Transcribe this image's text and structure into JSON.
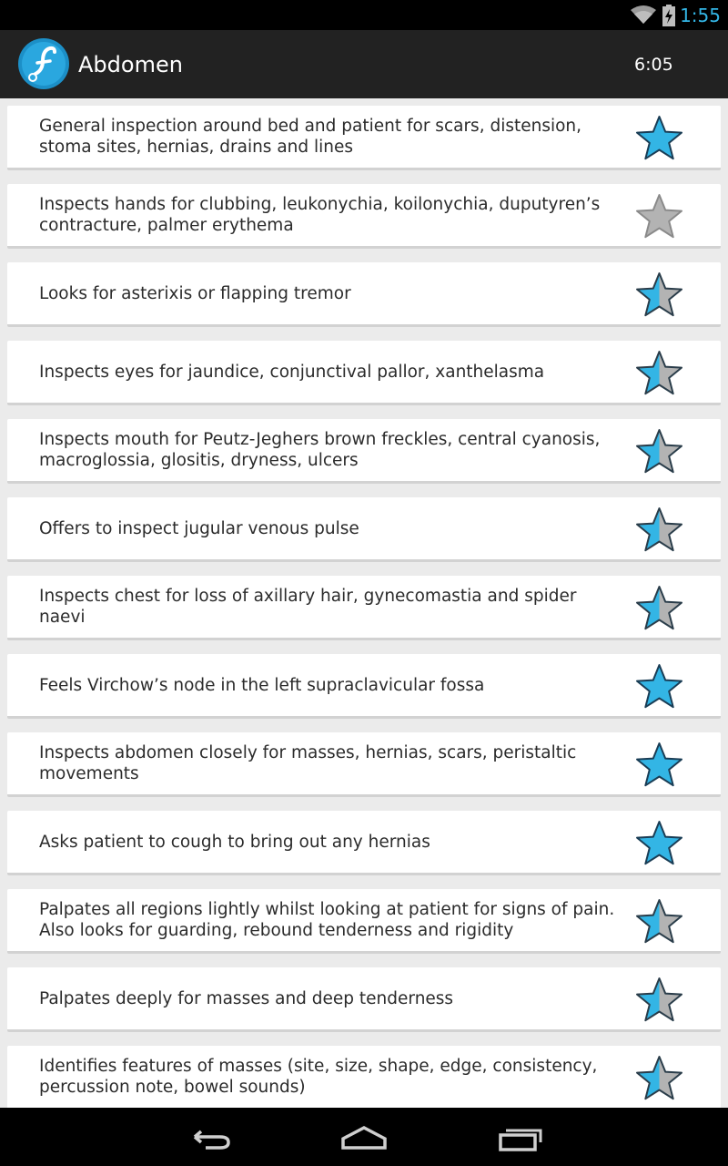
{
  "status_bar": {
    "time": "1:55",
    "icons": [
      "wifi-icon",
      "battery-charging-icon"
    ]
  },
  "action_bar": {
    "app_icon": "app-logo-icon",
    "title": "Abdomen",
    "timer": "6:05"
  },
  "colors": {
    "accent_blue": "#33b5e5",
    "star_gray": "#b3b3b3",
    "action_bar_bg": "#222222"
  },
  "items": [
    {
      "text": "General inspection around bed and patient for scars, distension, stoma sites, hernias, drains and lines",
      "rating": "full"
    },
    {
      "text": "Inspects hands for clubbing, leukonychia, koilonychia, duputyren’s contracture, palmer erythema",
      "rating": "empty"
    },
    {
      "text": "Looks for asterixis or flapping tremor",
      "rating": "half"
    },
    {
      "text": "Inspects eyes for jaundice, conjunctival pallor, xanthelasma",
      "rating": "half"
    },
    {
      "text": "Inspects mouth for Peutz-Jeghers brown freckles, central cyanosis, macroglossia, glositis, dryness, ulcers",
      "rating": "half"
    },
    {
      "text": "Offers to inspect jugular venous pulse",
      "rating": "half"
    },
    {
      "text": "Inspects chest for loss of axillary hair, gynecomastia and spider naevi",
      "rating": "half"
    },
    {
      "text": "Feels Virchow’s node in the left supraclavicular fossa",
      "rating": "full"
    },
    {
      "text": "Inspects abdomen closely for masses, hernias, scars, peristaltic movements",
      "rating": "full"
    },
    {
      "text": "Asks patient to cough to bring out any hernias",
      "rating": "full"
    },
    {
      "text": "Palpates all regions lightly whilst looking at patient for signs of pain. Also looks for guarding, rebound tenderness and rigidity",
      "rating": "half"
    },
    {
      "text": "Palpates deeply for masses and deep tenderness",
      "rating": "half"
    },
    {
      "text": "Identifies features of masses (site, size, shape, edge, consistency, percussion note, bowel sounds)",
      "rating": "half"
    }
  ],
  "nav_bar": {
    "buttons": [
      "back-icon",
      "home-icon",
      "recent-apps-icon"
    ]
  }
}
